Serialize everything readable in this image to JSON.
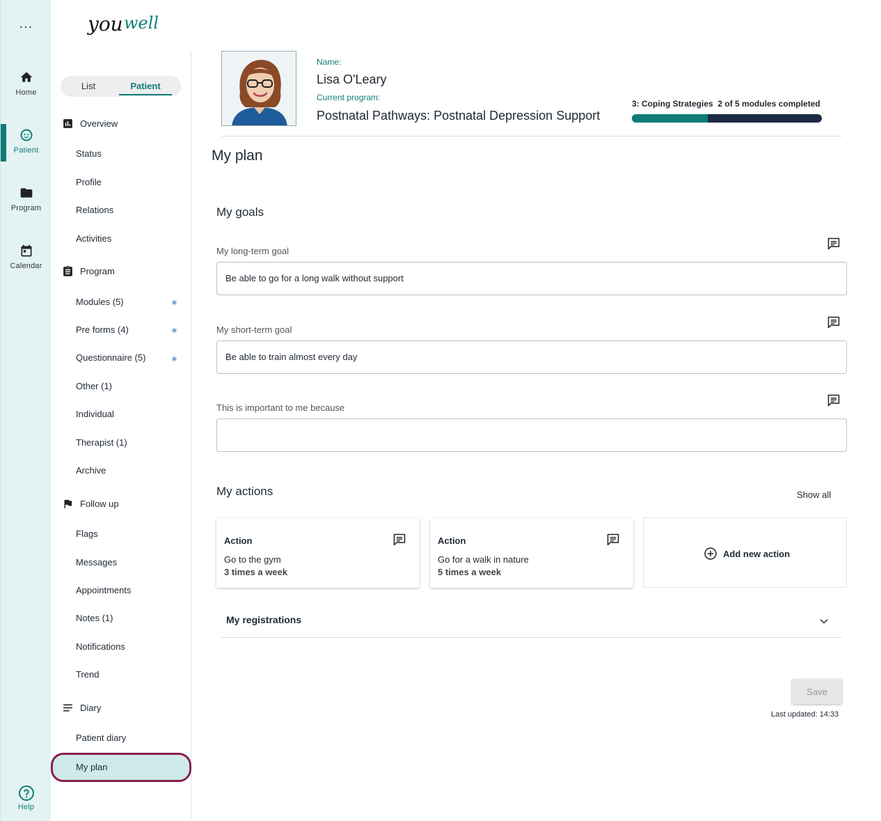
{
  "app": {
    "logo_text": "youwell",
    "accent_color": "#0e7d77"
  },
  "rail": {
    "more": "...",
    "items": [
      {
        "label": "Home",
        "icon": "home-icon"
      },
      {
        "label": "Patient",
        "icon": "patient-icon",
        "active": true
      },
      {
        "label": "Program",
        "icon": "folder-icon"
      },
      {
        "label": "Calendar",
        "icon": "calendar-icon"
      }
    ],
    "help": "Help"
  },
  "sidebar": {
    "toggle": {
      "list": "List",
      "patient": "Patient"
    },
    "overview": {
      "label": "Overview",
      "items": [
        "Status",
        "Profile",
        "Relations",
        "Activities"
      ]
    },
    "program": {
      "label": "Program",
      "items": [
        "Modules (5)",
        "Pre forms (4)",
        "Questionnaire (5)",
        "Other (1)",
        "Individual",
        "Therapist (1)",
        "Archive"
      ]
    },
    "followup": {
      "label": "Follow up",
      "items": [
        "Flags",
        "Messages",
        "Appointments",
        "Notes (1)",
        "Notifications",
        "Trend"
      ]
    },
    "diary": {
      "label": "Diary",
      "items": [
        "Patient diary",
        "My plan"
      ]
    }
  },
  "patient": {
    "name_label": "Name:",
    "name": "Lisa O'Leary",
    "program_label": "Current program:",
    "program": "Postnatal Pathways: Postnatal Depression Support",
    "module": "3: Coping Strategies",
    "modules_completed": "2 of 5 modules completed",
    "progress": 0.4
  },
  "page": {
    "title": "My plan",
    "goals": {
      "heading": "My goals",
      "long_label": "My long-term goal",
      "long_value": "Be able to go for a long walk without support",
      "short_label": "My short-term goal",
      "short_value": "Be able to train almost every day",
      "important_label": "This is important to me because",
      "important_value": ""
    },
    "actions": {
      "heading": "My actions",
      "show_all": "Show all",
      "cards": [
        {
          "title": "Action",
          "text": "Go to the gym",
          "freq": "3 times a week"
        },
        {
          "title": "Action",
          "text": "Go for a walk in nature",
          "freq": "5 times a week"
        }
      ],
      "add": "Add new action"
    },
    "registrations": "My registrations",
    "save": "Save",
    "last_updated": "Last updated: 14:33"
  }
}
